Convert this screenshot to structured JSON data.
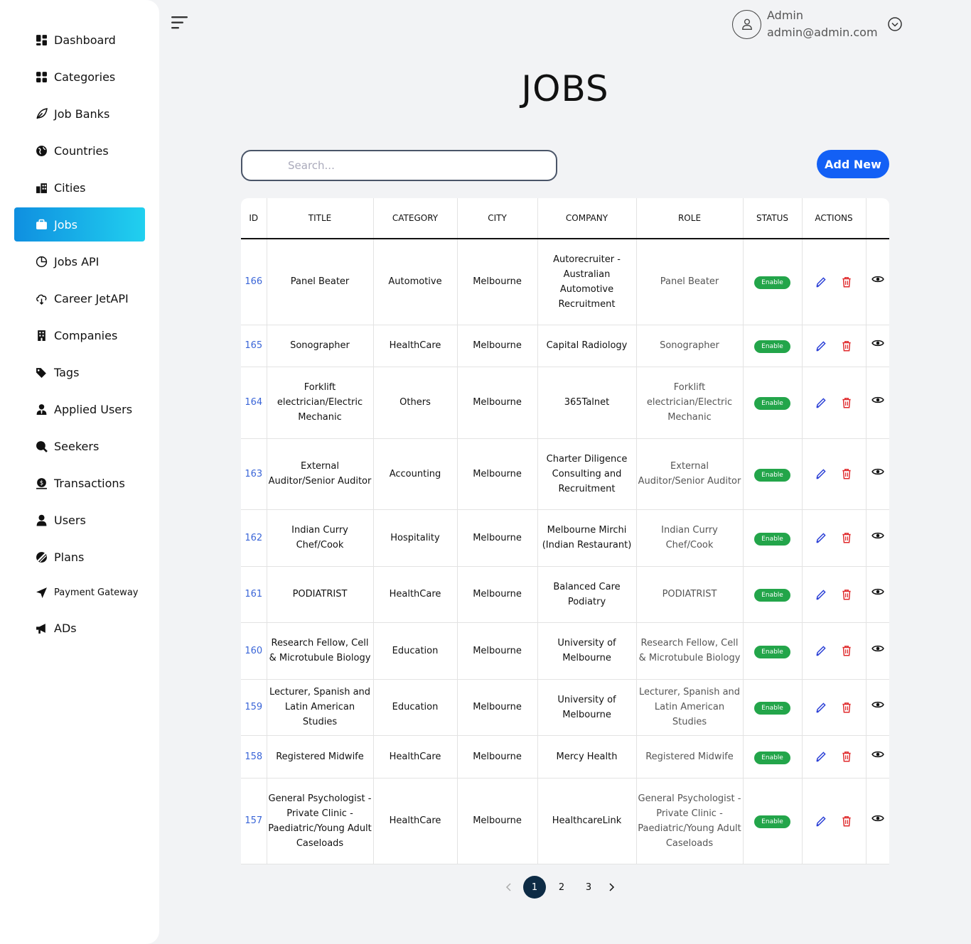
{
  "sidebar": {
    "items": [
      {
        "label": "Dashboard",
        "icon": "dashboard-icon"
      },
      {
        "label": "Categories",
        "icon": "categories-icon"
      },
      {
        "label": "Job Banks",
        "icon": "leaf-icon"
      },
      {
        "label": "Countries",
        "icon": "globe-icon"
      },
      {
        "label": "Cities",
        "icon": "city-icon"
      },
      {
        "label": "Jobs",
        "icon": "briefcase-icon",
        "active": true
      },
      {
        "label": "Jobs API",
        "icon": "pie-icon"
      },
      {
        "label": "Career JetAPI",
        "icon": "cloud-download-icon"
      },
      {
        "label": "Companies",
        "icon": "building-icon"
      },
      {
        "label": "Tags",
        "icon": "tags-icon"
      },
      {
        "label": "Applied Users",
        "icon": "user-tie-icon"
      },
      {
        "label": "Seekers",
        "icon": "search-icon"
      },
      {
        "label": "Transactions",
        "icon": "money-icon"
      },
      {
        "label": "Users",
        "icon": "user-icon"
      },
      {
        "label": "Plans",
        "icon": "plans-icon"
      },
      {
        "label": "Payment Gateway",
        "icon": "send-icon"
      },
      {
        "label": "ADs",
        "icon": "megaphone-icon"
      }
    ]
  },
  "header": {
    "user_name": "Admin",
    "user_email": "admin@admin.com"
  },
  "page": {
    "title": "JOBS",
    "search_placeholder": "Search...",
    "add_button": "Add New"
  },
  "table": {
    "columns": [
      "ID",
      "TITLE",
      "CATEGORY",
      "CITY",
      "COMPANY",
      "ROLE",
      "STATUS",
      "ACTIONS",
      ""
    ],
    "rows": [
      {
        "id": "166",
        "title": "Panel Beater",
        "category": "Automotive",
        "city": "Melbourne",
        "company": "Autorecruiter - Australian Automotive Recruitment",
        "role": "Panel Beater",
        "status": "Enable"
      },
      {
        "id": "165",
        "title": "Sonographer",
        "category": "HealthCare",
        "city": "Melbourne",
        "company": "Capital Radiology",
        "role": "Sonographer",
        "status": "Enable"
      },
      {
        "id": "164",
        "title": "Forklift electrician/Electric Mechanic",
        "category": "Others",
        "city": "Melbourne",
        "company": "365Talnet",
        "role": "Forklift electrician/Electric Mechanic",
        "status": "Enable"
      },
      {
        "id": "163",
        "title": "External Auditor/Senior Auditor",
        "category": "Accounting",
        "city": "Melbourne",
        "company": "Charter Diligence Consulting and Recruitment",
        "role": "External Auditor/Senior Auditor",
        "status": "Enable"
      },
      {
        "id": "162",
        "title": "Indian Curry Chef/Cook",
        "category": "Hospitality",
        "city": "Melbourne",
        "company": "Melbourne Mirchi (Indian Restaurant)",
        "role": "Indian Curry Chef/Cook",
        "status": "Enable"
      },
      {
        "id": "161",
        "title": "PODIATRIST",
        "category": "HealthCare",
        "city": "Melbourne",
        "company": "Balanced Care Podiatry",
        "role": "PODIATRIST",
        "status": "Enable"
      },
      {
        "id": "160",
        "title": "Research Fellow, Cell & Microtubule Biology",
        "category": "Education",
        "city": "Melbourne",
        "company": "University of Melbourne",
        "role": "Research Fellow, Cell & Microtubule Biology",
        "status": "Enable"
      },
      {
        "id": "159",
        "title": "Lecturer, Spanish and Latin American Studies",
        "category": "Education",
        "city": "Melbourne",
        "company": "University of Melbourne",
        "role": "Lecturer, Spanish and Latin American Studies",
        "status": "Enable"
      },
      {
        "id": "158",
        "title": "Registered Midwife",
        "category": "HealthCare",
        "city": "Melbourne",
        "company": "Mercy Health",
        "role": "Registered Midwife",
        "status": "Enable"
      },
      {
        "id": "157",
        "title": "General Psychologist - Private Clinic - Paediatric/Young Adult Caseloads",
        "category": "HealthCare",
        "city": "Melbourne",
        "company": "HealthcareLink",
        "role": "General Psychologist - Private Clinic - Paediatric/Young Adult Caseloads",
        "status": "Enable"
      }
    ]
  },
  "pagination": {
    "pages": [
      "1",
      "2",
      "3"
    ],
    "current": "1"
  },
  "colors": {
    "accent": "#1360f5",
    "active_nav_start": "#0f8fe0",
    "active_nav_end": "#21d0ef",
    "enable_badge": "#23a54a",
    "delete": "#e0292b",
    "edit": "#2a3fd6",
    "id_link": "#3b66d8"
  }
}
